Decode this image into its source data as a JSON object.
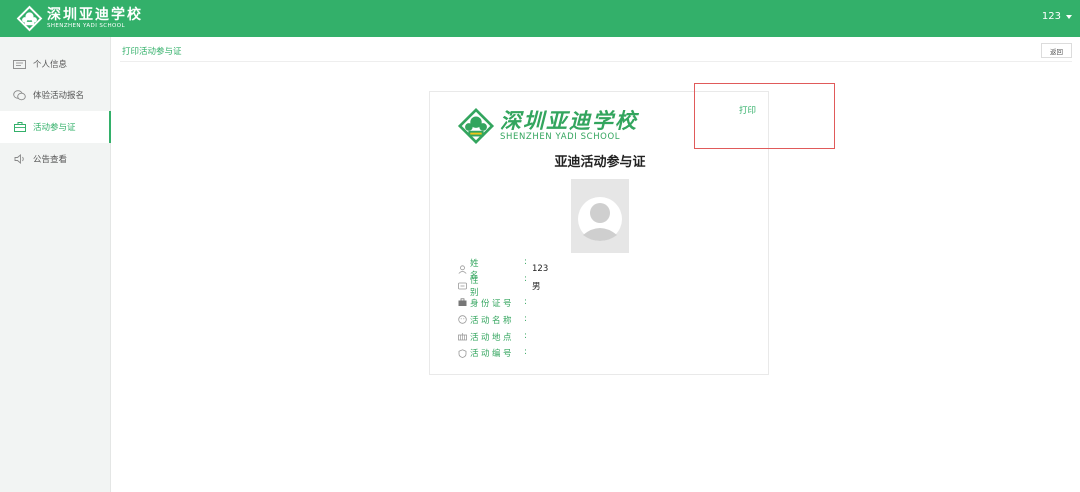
{
  "header": {
    "logo_cn": "深圳亚迪学校",
    "logo_en": "SHENZHEN YADI SCHOOL",
    "user_name": "123",
    "brand_color": "#33b06a"
  },
  "sidebar": {
    "items": [
      {
        "label": "个人信息",
        "icon": "id-card-icon"
      },
      {
        "label": "体验活动报名",
        "icon": "chat-bubbles-icon"
      },
      {
        "label": "活动参与证",
        "icon": "briefcase-icon",
        "active": true
      },
      {
        "label": "公告查看",
        "icon": "speaker-icon"
      }
    ]
  },
  "breadcrumb": "打印活动参与证",
  "back_button": "返回",
  "print_button": "打印",
  "card": {
    "logo_cn": "深圳亚迪学校",
    "logo_en": "SHENZHEN YADI SCHOOL",
    "title": "亚迪活动参与证",
    "fields": [
      {
        "label": "姓名",
        "value": "123",
        "icon": "person-icon"
      },
      {
        "label": "性别",
        "value": "男",
        "icon": "gender-icon"
      },
      {
        "label": "身份证号",
        "value": "",
        "icon": "id-icon"
      },
      {
        "label": "活动名称",
        "value": "",
        "icon": "activity-icon"
      },
      {
        "label": "活动地点",
        "value": "",
        "icon": "location-icon"
      },
      {
        "label": "活动编号",
        "value": "",
        "icon": "number-icon"
      }
    ]
  }
}
